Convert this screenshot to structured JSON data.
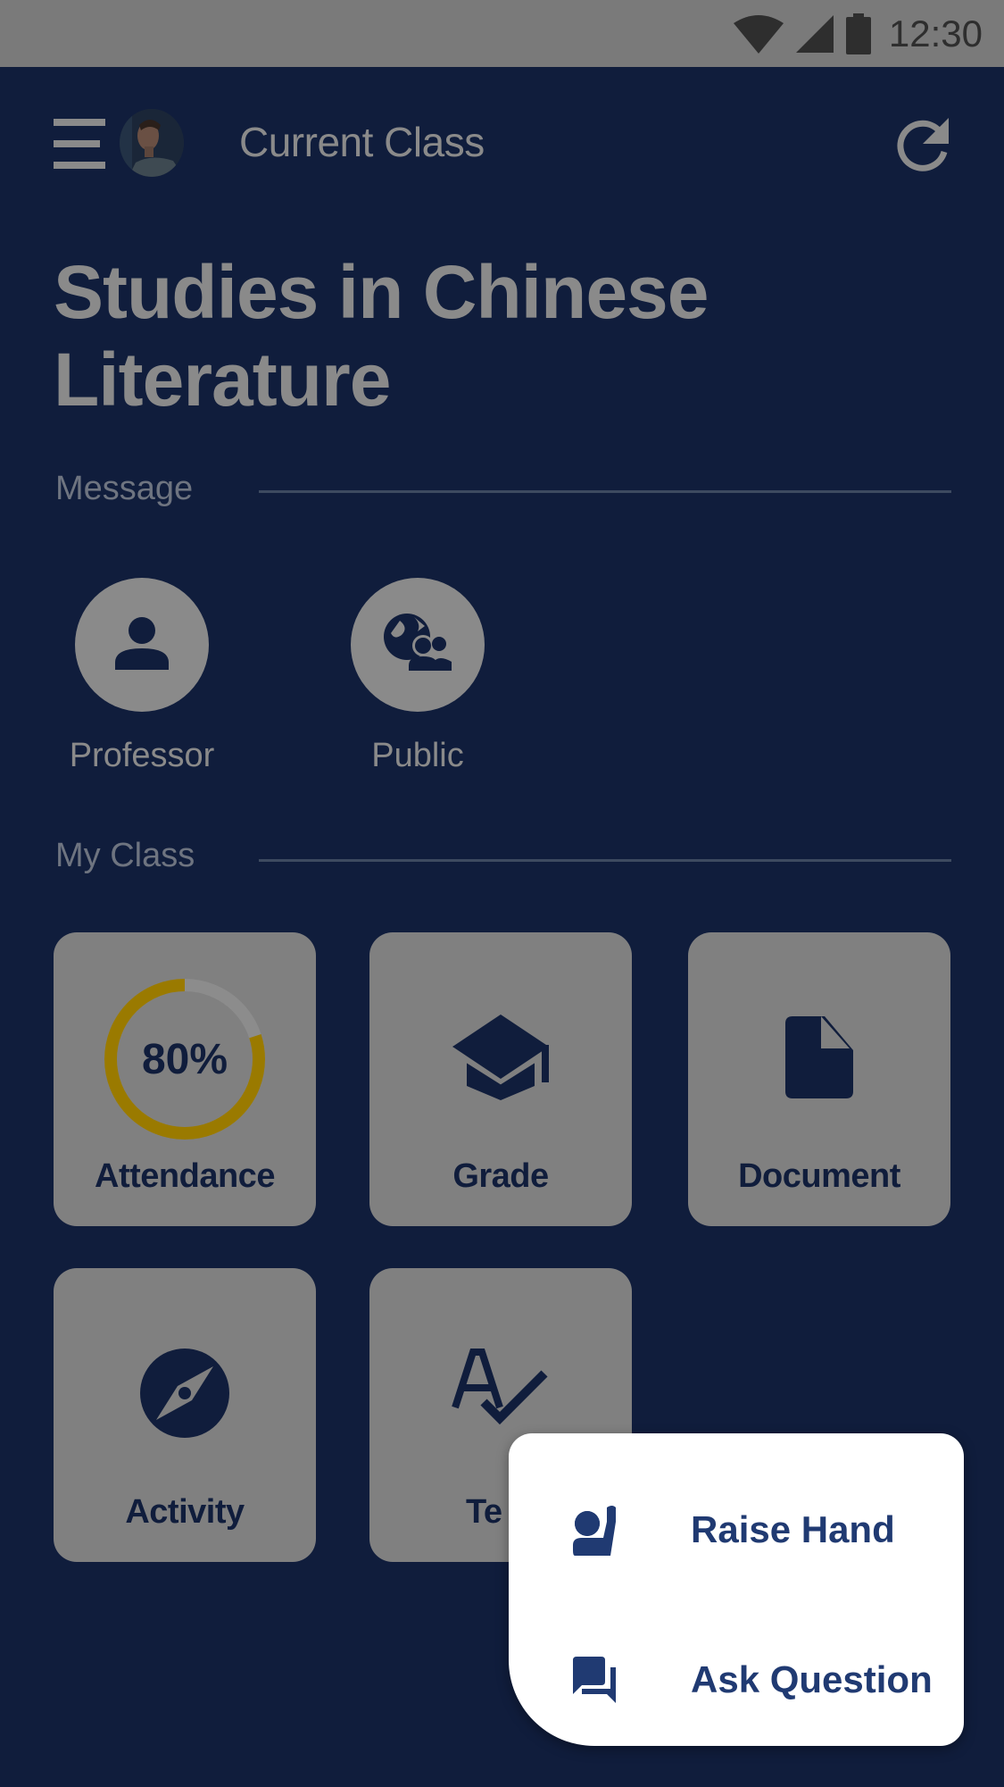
{
  "status_bar": {
    "time": "12:30",
    "icons": [
      "wifi-icon",
      "cellular-signal-icon",
      "battery-icon"
    ]
  },
  "app_bar": {
    "title": "Current Class",
    "menu_icon": "hamburger-menu-icon",
    "avatar": "user-avatar-photo",
    "refresh_icon": "refresh-icon"
  },
  "page": {
    "title": "Studies in Chinese Literature"
  },
  "message_section": {
    "label": "Message",
    "items": [
      {
        "label": "Professor",
        "icon": "person-icon"
      },
      {
        "label": "Public",
        "icon": "public-group-icon"
      }
    ]
  },
  "my_class_section": {
    "label": "My Class",
    "tiles": [
      {
        "label": "Attendance",
        "type": "progress-ring",
        "progress_percent": 80,
        "progress_text": "80%"
      },
      {
        "label": "Grade",
        "icon": "graduation-cap-icon"
      },
      {
        "label": "Document",
        "icon": "document-icon"
      },
      {
        "label": "Activity",
        "icon": "compass-icon"
      },
      {
        "label": "Te",
        "icon": "spellcheck-icon"
      }
    ]
  },
  "popup_menu": {
    "items": [
      {
        "label": "Raise Hand",
        "icon": "raise-hand-icon"
      },
      {
        "label": "Ask Question",
        "icon": "forum-icon"
      }
    ]
  },
  "colors": {
    "background": "#101d3c",
    "status_bar": "#7a7a7a",
    "dimmed_text": "#8a8a8a",
    "tile": "#808080",
    "ring_progress": "#9a7a00",
    "ring_track": "#8c8c8c",
    "popup_bg": "#ffffff",
    "popup_accent": "#203a72"
  }
}
